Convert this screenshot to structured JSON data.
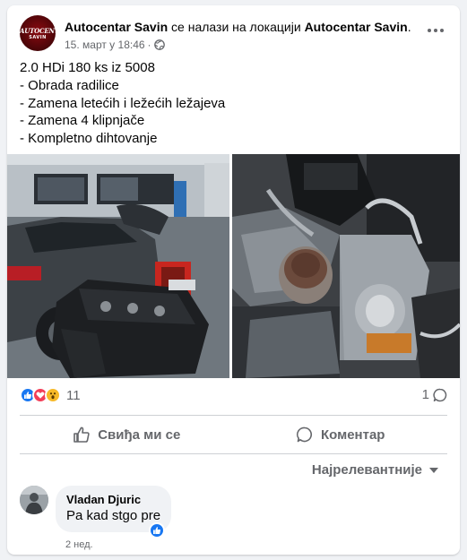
{
  "post": {
    "page_name": "Autocentar Savin",
    "location_text": "се налази на локацији",
    "location_name": "Autocentar Savin",
    "location_dot": ".",
    "timestamp": "15. март у 18:46",
    "separator": "·",
    "avatar_text_line1": "AUTOCENTAR",
    "avatar_text_line2": "SAVIN",
    "body_lines": [
      "2.0 HDi 180 ks iz 5008",
      "- Obrada radilice",
      "- Zamena letećih i ležećih ležajeva",
      "- Zamena 4 klipnjače",
      "- Kompletno dihtovanje"
    ],
    "reaction_icons": [
      "like-icon",
      "love-icon",
      "wow-icon"
    ],
    "reaction_count": "11",
    "comment_count": "1"
  },
  "actions": {
    "like_label": "Свиђа ми се",
    "comment_label": "Коментар"
  },
  "comments": {
    "sort_label": "Најрелевантније",
    "items": [
      {
        "author": "Vladan Djuric",
        "text": "Pa kad stgo pre",
        "time": "2 нед."
      }
    ]
  },
  "colors": {
    "background": "#f0f2f5",
    "card": "#ffffff",
    "text_primary": "#050505",
    "text_secondary": "#65676b",
    "accent_blue": "#1877f2",
    "love_red": "#f33e58",
    "wow_yellow": "#f7b928"
  }
}
